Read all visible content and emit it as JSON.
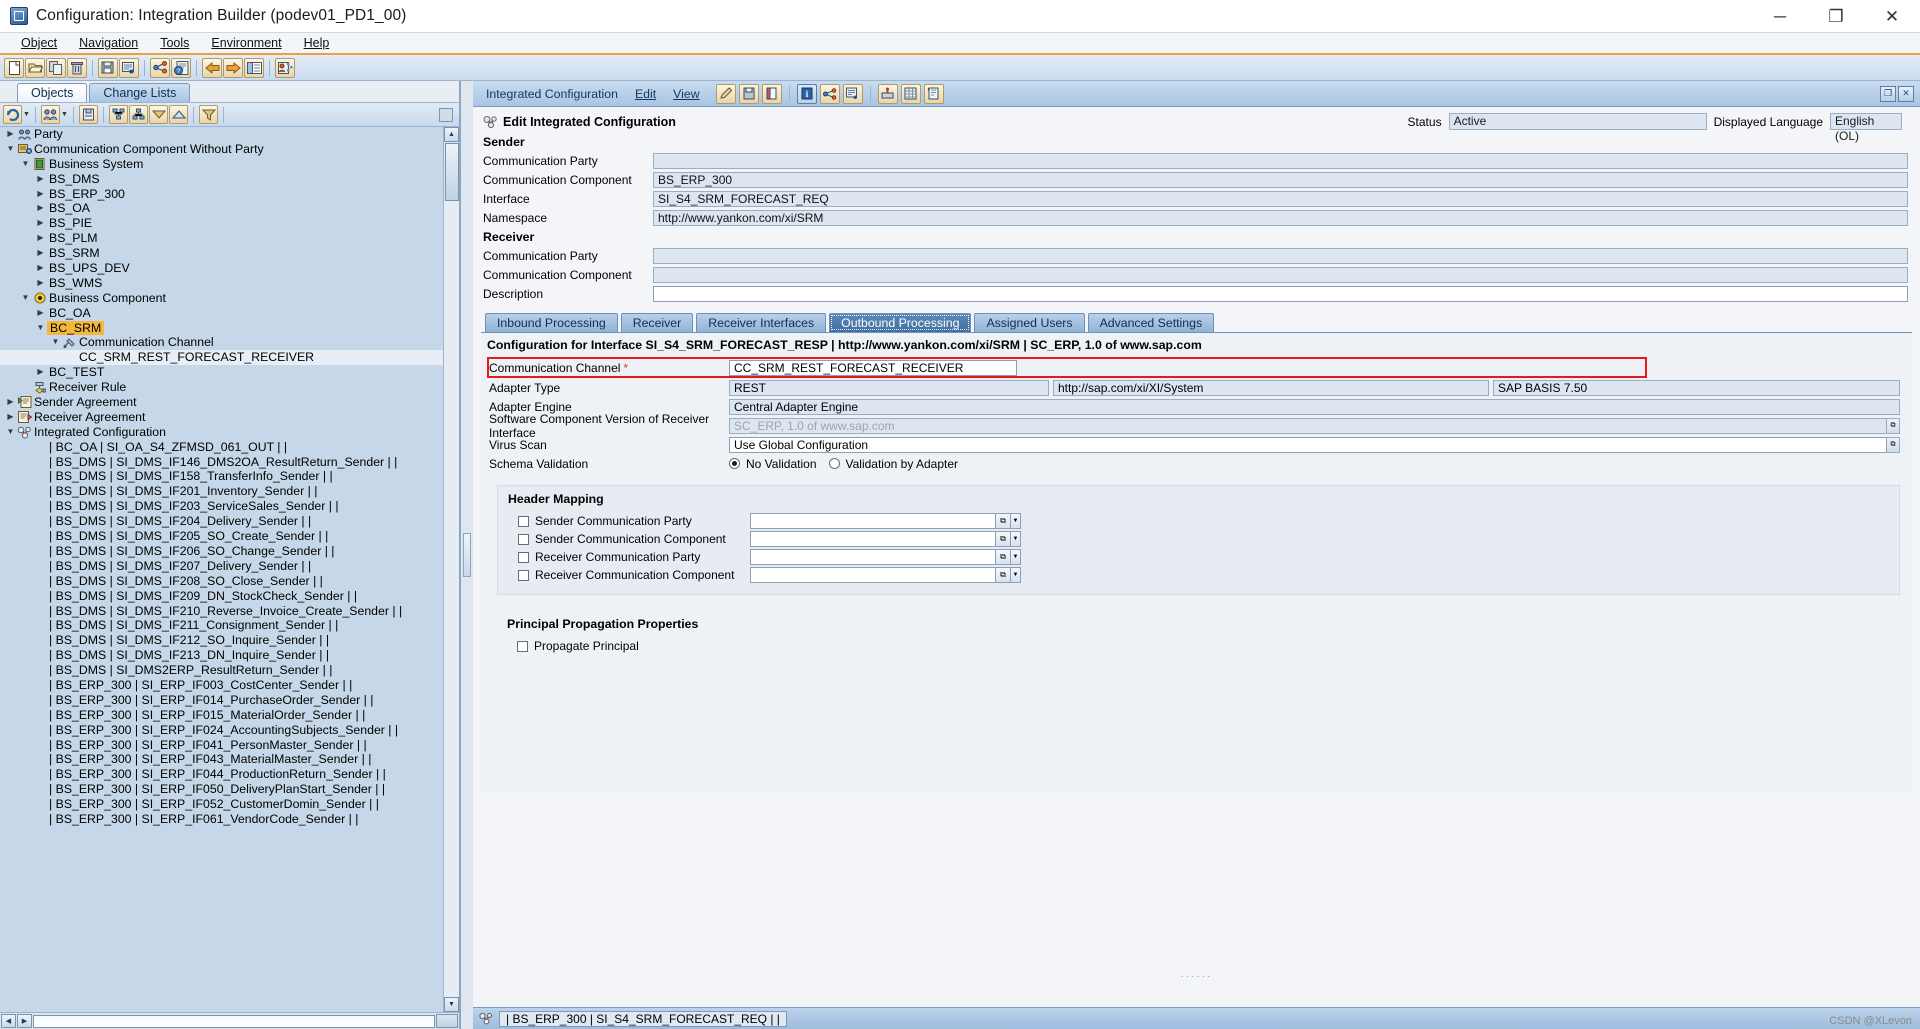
{
  "window": {
    "title": "Configuration: Integration Builder (podev01_PD1_00)",
    "minimize": "─",
    "maximize": "❐",
    "close": "✕"
  },
  "menubar": [
    {
      "label": "Object"
    },
    {
      "label": "Navigation"
    },
    {
      "label": "Tools"
    },
    {
      "label": "Environment"
    },
    {
      "label": "Help"
    }
  ],
  "toolbar": {
    "buttons": [
      {
        "name": "new-icon"
      },
      {
        "name": "open-folder-icon"
      },
      {
        "name": "copy-icon"
      },
      {
        "name": "delete-icon"
      },
      {
        "name": "save-all-icon"
      },
      {
        "name": "check-object-icon"
      },
      {
        "name": "where-used-icon"
      },
      {
        "name": "help-object-icon"
      },
      {
        "name": "back-arrow-icon"
      },
      {
        "name": "forward-arrow-icon"
      },
      {
        "name": "list-view-icon"
      },
      {
        "name": "user-settings-icon"
      }
    ]
  },
  "left_panel": {
    "tabs": [
      {
        "label": "Objects",
        "active": true
      },
      {
        "label": "Change Lists",
        "active": false
      }
    ],
    "toolbar_buttons": [
      {
        "name": "refresh-icon"
      },
      {
        "name": "find-objects-icon"
      },
      {
        "name": "search-icon"
      },
      {
        "name": "expand-node-icon"
      },
      {
        "name": "collapse-node-icon"
      },
      {
        "name": "collapse-all-icon"
      },
      {
        "name": "expand-all-icon"
      },
      {
        "name": "filter-icon"
      }
    ],
    "tree": [
      {
        "label": "Party",
        "depth": 0,
        "arrow": "right",
        "icon": "party-icon"
      },
      {
        "label": "Communication Component Without Party",
        "depth": 0,
        "arrow": "down",
        "icon": "component-icon"
      },
      {
        "label": "Business System",
        "depth": 1,
        "arrow": "down",
        "icon": "business-system-icon"
      },
      {
        "label": "BS_DMS",
        "depth": 2,
        "arrow": "right",
        "icon": ""
      },
      {
        "label": "BS_ERP_300",
        "depth": 2,
        "arrow": "right",
        "icon": ""
      },
      {
        "label": "BS_OA",
        "depth": 2,
        "arrow": "right",
        "icon": ""
      },
      {
        "label": "BS_PIE",
        "depth": 2,
        "arrow": "right",
        "icon": ""
      },
      {
        "label": "BS_PLM",
        "depth": 2,
        "arrow": "right",
        "icon": ""
      },
      {
        "label": "BS_SRM",
        "depth": 2,
        "arrow": "right",
        "icon": ""
      },
      {
        "label": "BS_UPS_DEV",
        "depth": 2,
        "arrow": "right",
        "icon": ""
      },
      {
        "label": "BS_WMS",
        "depth": 2,
        "arrow": "right",
        "icon": ""
      },
      {
        "label": "Business Component",
        "depth": 1,
        "arrow": "down",
        "icon": "business-component-icon"
      },
      {
        "label": "BC_OA",
        "depth": 2,
        "arrow": "right",
        "icon": ""
      },
      {
        "label": "BC_SRM",
        "depth": 2,
        "arrow": "down",
        "icon": "",
        "selected": true
      },
      {
        "label": "Communication Channel",
        "depth": 3,
        "arrow": "down",
        "icon": "channel-icon"
      },
      {
        "label": "CC_SRM_REST_FORECAST_RECEIVER",
        "depth": 4,
        "arrow": "",
        "icon": "",
        "highlight_row": true
      },
      {
        "label": "BC_TEST",
        "depth": 2,
        "arrow": "right",
        "icon": ""
      },
      {
        "label": "Receiver Rule",
        "depth": 1,
        "arrow": "",
        "icon": "receiver-rule-icon"
      },
      {
        "label": "Sender Agreement",
        "depth": 0,
        "arrow": "right",
        "icon": "sender-agreement-icon"
      },
      {
        "label": "Receiver Agreement",
        "depth": 0,
        "arrow": "right",
        "icon": "receiver-agreement-icon"
      },
      {
        "label": "Integrated Configuration",
        "depth": 0,
        "arrow": "down",
        "icon": "integrated-config-icon"
      },
      {
        "label": "| BC_OA | SI_OA_S4_ZFMSD_061_OUT | |",
        "depth": 2,
        "arrow": "",
        "icon": ""
      },
      {
        "label": "| BS_DMS | SI_DMS_IF146_DMS2OA_ResultReturn_Sender | |",
        "depth": 2,
        "arrow": "",
        "icon": ""
      },
      {
        "label": "| BS_DMS | SI_DMS_IF158_TransferInfo_Sender | |",
        "depth": 2,
        "arrow": "",
        "icon": ""
      },
      {
        "label": "| BS_DMS | SI_DMS_IF201_Inventory_Sender | |",
        "depth": 2,
        "arrow": "",
        "icon": ""
      },
      {
        "label": "| BS_DMS | SI_DMS_IF203_ServiceSales_Sender | |",
        "depth": 2,
        "arrow": "",
        "icon": ""
      },
      {
        "label": "| BS_DMS | SI_DMS_IF204_Delivery_Sender | |",
        "depth": 2,
        "arrow": "",
        "icon": ""
      },
      {
        "label": "| BS_DMS | SI_DMS_IF205_SO_Create_Sender | |",
        "depth": 2,
        "arrow": "",
        "icon": ""
      },
      {
        "label": "| BS_DMS | SI_DMS_IF206_SO_Change_Sender | |",
        "depth": 2,
        "arrow": "",
        "icon": ""
      },
      {
        "label": "| BS_DMS | SI_DMS_IF207_Delivery_Sender | |",
        "depth": 2,
        "arrow": "",
        "icon": ""
      },
      {
        "label": "| BS_DMS | SI_DMS_IF208_SO_Close_Sender | |",
        "depth": 2,
        "arrow": "",
        "icon": ""
      },
      {
        "label": "| BS_DMS | SI_DMS_IF209_DN_StockCheck_Sender | |",
        "depth": 2,
        "arrow": "",
        "icon": ""
      },
      {
        "label": "| BS_DMS | SI_DMS_IF210_Reverse_Invoice_Create_Sender | |",
        "depth": 2,
        "arrow": "",
        "icon": ""
      },
      {
        "label": "| BS_DMS | SI_DMS_IF211_Consignment_Sender | |",
        "depth": 2,
        "arrow": "",
        "icon": ""
      },
      {
        "label": "| BS_DMS | SI_DMS_IF212_SO_Inquire_Sender | |",
        "depth": 2,
        "arrow": "",
        "icon": ""
      },
      {
        "label": "| BS_DMS | SI_DMS_IF213_DN_Inquire_Sender | |",
        "depth": 2,
        "arrow": "",
        "icon": ""
      },
      {
        "label": "| BS_DMS | SI_DMS2ERP_ResultReturn_Sender | |",
        "depth": 2,
        "arrow": "",
        "icon": ""
      },
      {
        "label": "| BS_ERP_300 | SI_ERP_IF003_CostCenter_Sender | |",
        "depth": 2,
        "arrow": "",
        "icon": ""
      },
      {
        "label": "| BS_ERP_300 | SI_ERP_IF014_PurchaseOrder_Sender | |",
        "depth": 2,
        "arrow": "",
        "icon": ""
      },
      {
        "label": "| BS_ERP_300 | SI_ERP_IF015_MaterialOrder_Sender | |",
        "depth": 2,
        "arrow": "",
        "icon": ""
      },
      {
        "label": "| BS_ERP_300 | SI_ERP_IF024_AccountingSubjects_Sender | |",
        "depth": 2,
        "arrow": "",
        "icon": ""
      },
      {
        "label": "| BS_ERP_300 | SI_ERP_IF041_PersonMaster_Sender | |",
        "depth": 2,
        "arrow": "",
        "icon": ""
      },
      {
        "label": "| BS_ERP_300 | SI_ERP_IF043_MaterialMaster_Sender | |",
        "depth": 2,
        "arrow": "",
        "icon": ""
      },
      {
        "label": "| BS_ERP_300 | SI_ERP_IF044_ProductionReturn_Sender | |",
        "depth": 2,
        "arrow": "",
        "icon": ""
      },
      {
        "label": "| BS_ERP_300 | SI_ERP_IF050_DeliveryPlanStart_Sender | |",
        "depth": 2,
        "arrow": "",
        "icon": ""
      },
      {
        "label": "| BS_ERP_300 | SI_ERP_IF052_CustomerDomin_Sender | |",
        "depth": 2,
        "arrow": "",
        "icon": ""
      },
      {
        "label": "| BS_ERP_300 | SI_ERP_IF061_VendorCode_Sender | |",
        "depth": 2,
        "arrow": "",
        "icon": ""
      }
    ]
  },
  "right_panel": {
    "menu": [
      {
        "label": "Integrated Configuration"
      },
      {
        "label": "Edit"
      },
      {
        "label": "View"
      }
    ],
    "toolbar_buttons": [
      {
        "name": "edit-pencil-icon"
      },
      {
        "name": "save-icon"
      },
      {
        "name": "copy-object-icon"
      },
      {
        "name": "info-icon"
      },
      {
        "name": "where-used-icon"
      },
      {
        "name": "check-icon"
      },
      {
        "name": "activate-icon"
      },
      {
        "name": "table-icon"
      },
      {
        "name": "history-icon"
      }
    ],
    "window_buttons": [
      {
        "name": "restore-icon",
        "glyph": "❐"
      },
      {
        "name": "close-panel-icon",
        "glyph": "✕"
      }
    ],
    "page_title": "Edit Integrated Configuration",
    "status_label": "Status",
    "status_value": "Active",
    "language_label": "Displayed Language",
    "language_value": "English (OL)",
    "sender": {
      "section_title": "Sender",
      "fields": [
        {
          "label": "Communication Party",
          "value": "",
          "readonly": true
        },
        {
          "label": "Communication Component",
          "value": "BS_ERP_300",
          "readonly": true
        },
        {
          "label": "Interface",
          "value": "SI_S4_SRM_FORECAST_REQ",
          "readonly": true
        },
        {
          "label": "Namespace",
          "value": "http://www.yankon.com/xi/SRM",
          "readonly": true
        }
      ]
    },
    "receiver": {
      "section_title": "Receiver",
      "fields": [
        {
          "label": "Communication Party",
          "value": "",
          "readonly": true
        },
        {
          "label": "Communication Component",
          "value": "",
          "readonly": true
        },
        {
          "label": "Description",
          "value": "",
          "readonly": false
        }
      ]
    },
    "tabs": [
      {
        "label": "Inbound Processing",
        "active": false
      },
      {
        "label": "Receiver",
        "active": false
      },
      {
        "label": "Receiver Interfaces",
        "active": false
      },
      {
        "label": "Outbound Processing",
        "active": true
      },
      {
        "label": "Assigned Users",
        "active": false
      },
      {
        "label": "Advanced Settings",
        "active": false
      }
    ],
    "config_title": "Configuration for Interface SI_S4_SRM_FORECAST_RESP | http://www.yankon.com/xi/SRM | SC_ERP, 1.0 of www.sap.com",
    "outbound": {
      "communication_channel_label": "Communication Channel",
      "required_marker": "*",
      "communication_channel_value": "CC_SRM_REST_FORECAST_RECEIVER",
      "adapter_type_label": "Adapter Type",
      "adapter_type_value": "REST",
      "adapter_type_namespace": "http://sap.com/xi/XI/System",
      "adapter_type_version": "SAP BASIS 7.50",
      "adapter_engine_label": "Adapter Engine",
      "adapter_engine_value": "Central Adapter Engine",
      "scv_label": "Software Component Version of Receiver Interface",
      "scv_value": "SC_ERP, 1.0 of www.sap.com",
      "virus_scan_label": "Virus Scan",
      "virus_scan_value": "Use Global Configuration",
      "schema_validation_label": "Schema Validation",
      "schema_options": [
        {
          "label": "No Validation",
          "selected": true
        },
        {
          "label": "Validation by Adapter",
          "selected": false
        }
      ]
    },
    "header_mapping": {
      "title": "Header Mapping",
      "rows": [
        {
          "label": "Sender Communication Party",
          "checked": false,
          "value": ""
        },
        {
          "label": "Sender Communication Component",
          "checked": false,
          "value": ""
        },
        {
          "label": "Receiver Communication Party",
          "checked": false,
          "value": ""
        },
        {
          "label": "Receiver Communication Component",
          "checked": false,
          "value": ""
        }
      ]
    },
    "principal_propagation": {
      "title": "Principal Propagation Properties",
      "rows": [
        {
          "label": "Propagate Principal",
          "checked": false
        }
      ]
    },
    "bottom_bar": {
      "icon": "integrated-config-icon",
      "text": "| BS_ERP_300 | SI_S4_SRM_FORECAST_REQ | |"
    }
  },
  "watermark": "CSDN @XLevon"
}
